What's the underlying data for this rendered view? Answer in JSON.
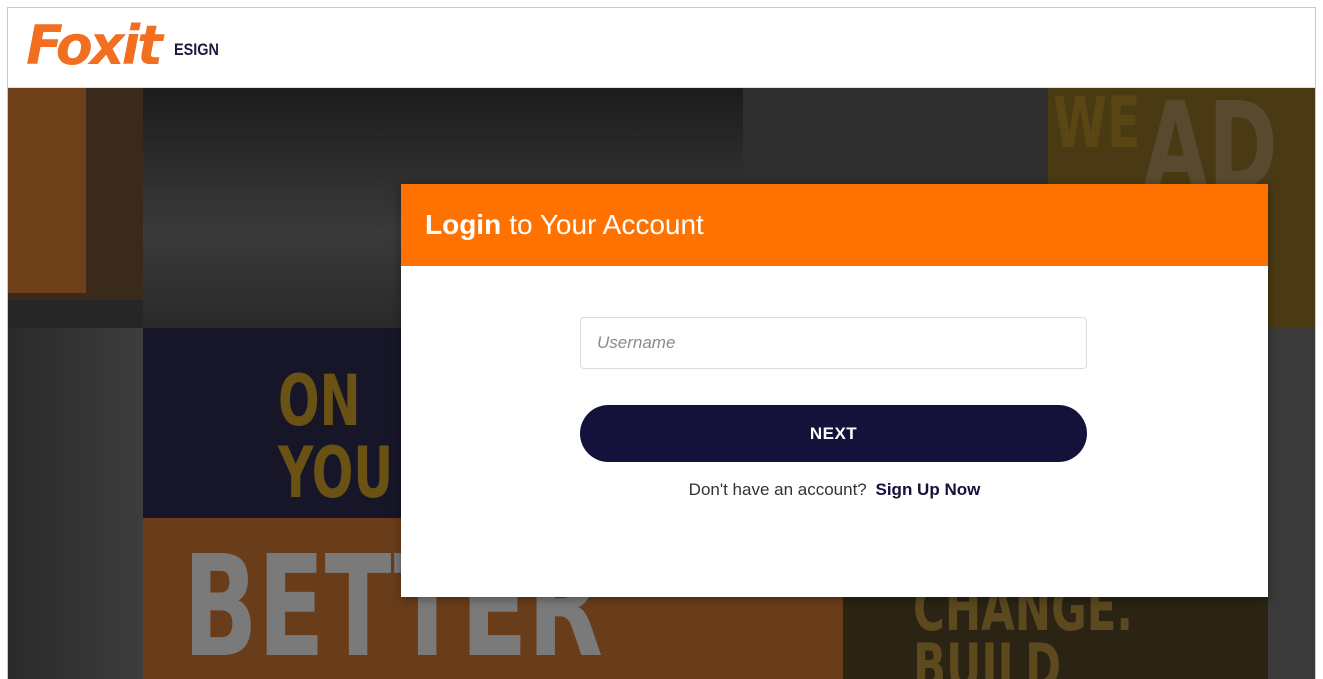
{
  "brand": {
    "logo_word": "Foxit",
    "product": "ESIGN",
    "accent_color": "#ff7200",
    "dark_color": "#14113a"
  },
  "background": {
    "texts": [
      "WE",
      "AD",
      "ON",
      "YOU",
      "BETTER",
      "CHANGE.",
      "BUILD"
    ]
  },
  "login": {
    "title_bold": "Login",
    "title_rest": "to Your Account",
    "username_placeholder": "Username",
    "username_value": "",
    "next_label": "NEXT",
    "signup_prompt": "Don't have an account?",
    "signup_link": "Sign Up Now"
  }
}
